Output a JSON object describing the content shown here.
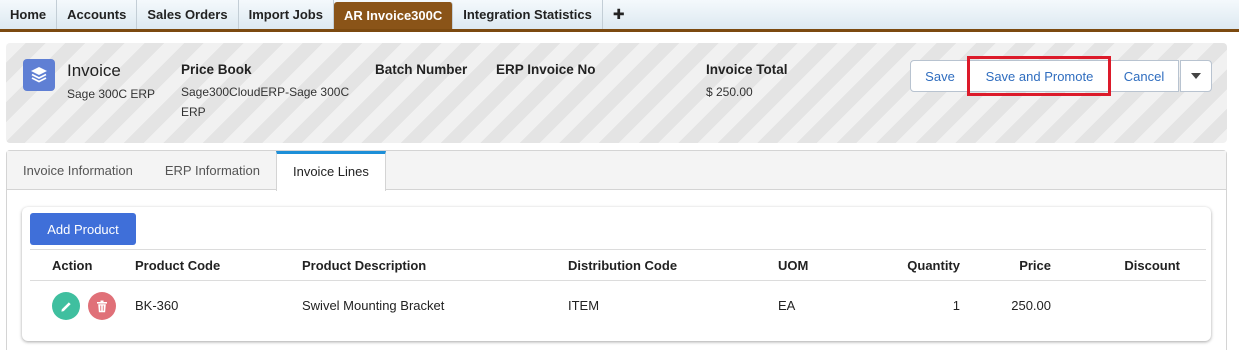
{
  "nav": {
    "tabs": [
      {
        "label": "Home"
      },
      {
        "label": "Accounts"
      },
      {
        "label": "Sales Orders"
      },
      {
        "label": "Import Jobs"
      },
      {
        "label": "AR Invoice300C",
        "active": true
      },
      {
        "label": "Integration Statistics"
      }
    ],
    "plus_label": "✚"
  },
  "header": {
    "object_icon": "layers-icon",
    "title": "Invoice",
    "subtitle": "Sage 300C ERP",
    "fields": {
      "price_book": {
        "label": "Price Book",
        "value_line1": "Sage300CloudERP-Sage 300C",
        "value_line2": "ERP"
      },
      "batch_number": {
        "label": "Batch Number",
        "value": ""
      },
      "erp_invoice_no": {
        "label": "ERP Invoice No",
        "value": ""
      },
      "invoice_total": {
        "label": "Invoice Total",
        "value": "$ 250.00"
      }
    },
    "buttons": {
      "save": "Save",
      "save_and_promote": "Save and Promote",
      "cancel": "Cancel",
      "more_icon": "caret-down-icon"
    },
    "highlight_color": "#dc1a2a"
  },
  "tabs": [
    {
      "label": "Invoice Information"
    },
    {
      "label": "ERP Information"
    },
    {
      "label": "Invoice Lines",
      "active": true
    }
  ],
  "invoice_lines": {
    "add_button": "Add Product",
    "columns": {
      "action": "Action",
      "product_code": "Product Code",
      "product_description": "Product Description",
      "distribution_code": "Distribution Code",
      "uom": "UOM",
      "quantity": "Quantity",
      "price": "Price",
      "discount": "Discount"
    },
    "rows": [
      {
        "product_code": "BK-360",
        "product_description": "Swivel Mounting Bracket",
        "distribution_code": "ITEM",
        "uom": "EA",
        "quantity": "1",
        "price": "250.00",
        "discount": ""
      }
    ]
  },
  "colors": {
    "active_nav_tab": "#8a5418",
    "object_icon_bg": "#5f7fd4",
    "primary_button": "#3f6fd9",
    "edit_action": "#3fbf9f",
    "delete_action": "#e07078",
    "active_tab_border": "#1d8fd8"
  }
}
